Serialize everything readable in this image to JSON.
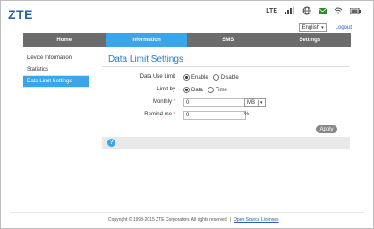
{
  "brand": {
    "logo_text": "ZTE"
  },
  "status": {
    "network_type": "LTE",
    "icons": [
      "signal-bars-icon",
      "globe-icon",
      "sms-envelope-icon",
      "wifi-icon",
      "battery-icon"
    ]
  },
  "lang": {
    "selected": "English",
    "logout_label": "Logout"
  },
  "nav": {
    "items": [
      {
        "label": "Home"
      },
      {
        "label": "Information"
      },
      {
        "label": "SMS"
      },
      {
        "label": "Settings"
      }
    ]
  },
  "sidebar": {
    "items": [
      {
        "label": "Device Information"
      },
      {
        "label": "Statistics"
      },
      {
        "label": "Data Limit Settings"
      }
    ]
  },
  "main": {
    "title": "Data Limit Settings",
    "data_use_limit": {
      "label": "Data Use Limit",
      "options": [
        "Enable",
        "Disable"
      ],
      "selected": "Enable"
    },
    "limit_by": {
      "label": "Limit by",
      "options": [
        "Data",
        "Time"
      ],
      "selected": "Data"
    },
    "monthly": {
      "label": "Monthly",
      "required_mark": "*",
      "value": "0",
      "unit": "MB"
    },
    "remind": {
      "label": "Remind me",
      "required_mark": "*",
      "value": "0",
      "suffix": "%"
    },
    "apply_label": "Apply",
    "help_glyph": "?"
  },
  "footer": {
    "copyright": "Copyright © 1998-2015 ZTE Corporation. All rights reserved",
    "separator": "|",
    "license_link": "Open Source Licenses"
  },
  "colors": {
    "accent": "#39a6ea",
    "nav_bg": "#6c6c6c",
    "title": "#2b7ac8",
    "logo": "#2b5fa8"
  }
}
